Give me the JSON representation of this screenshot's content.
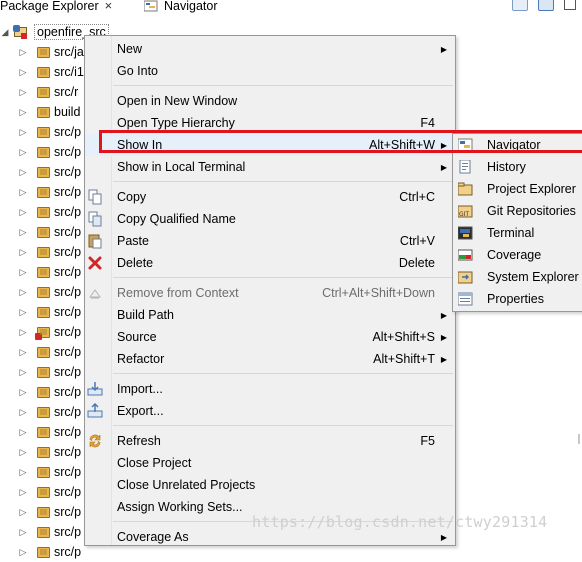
{
  "tabs": {
    "package_explorer": "Package Explorer",
    "navigator": "Navigator"
  },
  "tree": {
    "root": "openfire_src",
    "rows": [
      "src/ja",
      "src/i1",
      "src/r",
      "build",
      "src/p",
      "src/p",
      "src/p",
      "src/p",
      "src/p",
      "src/p",
      "src/p",
      "src/p",
      "src/p",
      "src/p",
      "src/p",
      "src/p",
      "src/p",
      "src/p",
      "src/p",
      "src/p",
      "src/p",
      "src/p",
      "src/p",
      "src/p",
      "src/p",
      "src/p"
    ]
  },
  "menu": {
    "new": "New",
    "go_into": "Go Into",
    "open_new_window": "Open in New Window",
    "open_type_hierarchy": "Open Type Hierarchy",
    "open_type_hierarchy_accel": "F4",
    "show_in": "Show In",
    "show_in_accel": "Alt+Shift+W",
    "show_in_local_terminal": "Show in Local Terminal",
    "copy": "Copy",
    "copy_accel": "Ctrl+C",
    "copy_qualified": "Copy Qualified Name",
    "paste": "Paste",
    "paste_accel": "Ctrl+V",
    "delete": "Delete",
    "delete_accel": "Delete",
    "remove_context": "Remove from Context",
    "remove_context_accel": "Ctrl+Alt+Shift+Down",
    "build_path": "Build Path",
    "source": "Source",
    "source_accel": "Alt+Shift+S",
    "refactor": "Refactor",
    "refactor_accel": "Alt+Shift+T",
    "import": "Import...",
    "export": "Export...",
    "refresh": "Refresh",
    "refresh_accel": "F5",
    "close_project": "Close Project",
    "close_unrelated": "Close Unrelated Projects",
    "assign_working_sets": "Assign Working Sets...",
    "coverage_as": "Coverage As"
  },
  "submenu": {
    "navigator": "Navigator",
    "history": "History",
    "project_explorer": "Project Explorer",
    "git_repositories": "Git Repositories",
    "terminal": "Terminal",
    "coverage": "Coverage",
    "system_explorer": "System Explorer",
    "properties": "Properties"
  },
  "watermark": "https://blog.csdn.net/ctwy291314",
  "colors": {
    "highlight_box": "#e0141c",
    "menu_bg": "#f0f0f0",
    "package_icon": "#e7b64f"
  }
}
